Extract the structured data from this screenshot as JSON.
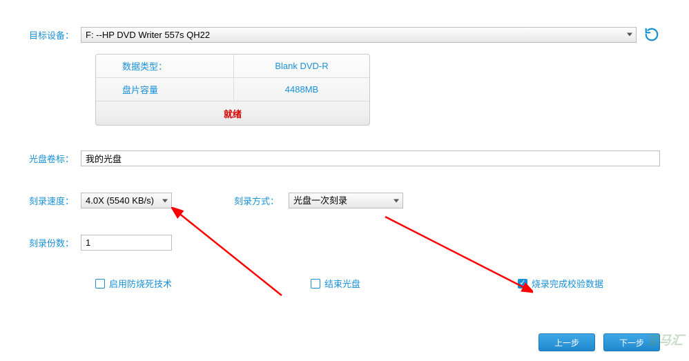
{
  "labels": {
    "target_device": "目标设备：",
    "disc_label": "光盘卷标：",
    "burn_speed": "刻录速度：",
    "burn_mode": "刻录方式：",
    "copies": "刻录份数："
  },
  "device": {
    "value": "F:   --HP      DVD Writer 557s   QH22"
  },
  "info": {
    "data_type_label": "数据类型：",
    "data_type_value": "Blank DVD-R",
    "capacity_label": "盘片容量",
    "capacity_value": "4488MB",
    "status": "就绪"
  },
  "disc_label_value": "我的光盘",
  "speed_value": "4.0X    (5540 KB/s)",
  "mode_value": "光盘一次刻录",
  "copies_value": "1",
  "checks": {
    "burnproof": {
      "label": "启用防烧死技术",
      "checked": false
    },
    "finalize": {
      "label": "结束光盘",
      "checked": false
    },
    "verify": {
      "label": "烧录完成校验数据",
      "checked": true
    }
  },
  "buttons": {
    "prev": "上一步",
    "next": "下一步"
  },
  "watermark": "宝马汇"
}
